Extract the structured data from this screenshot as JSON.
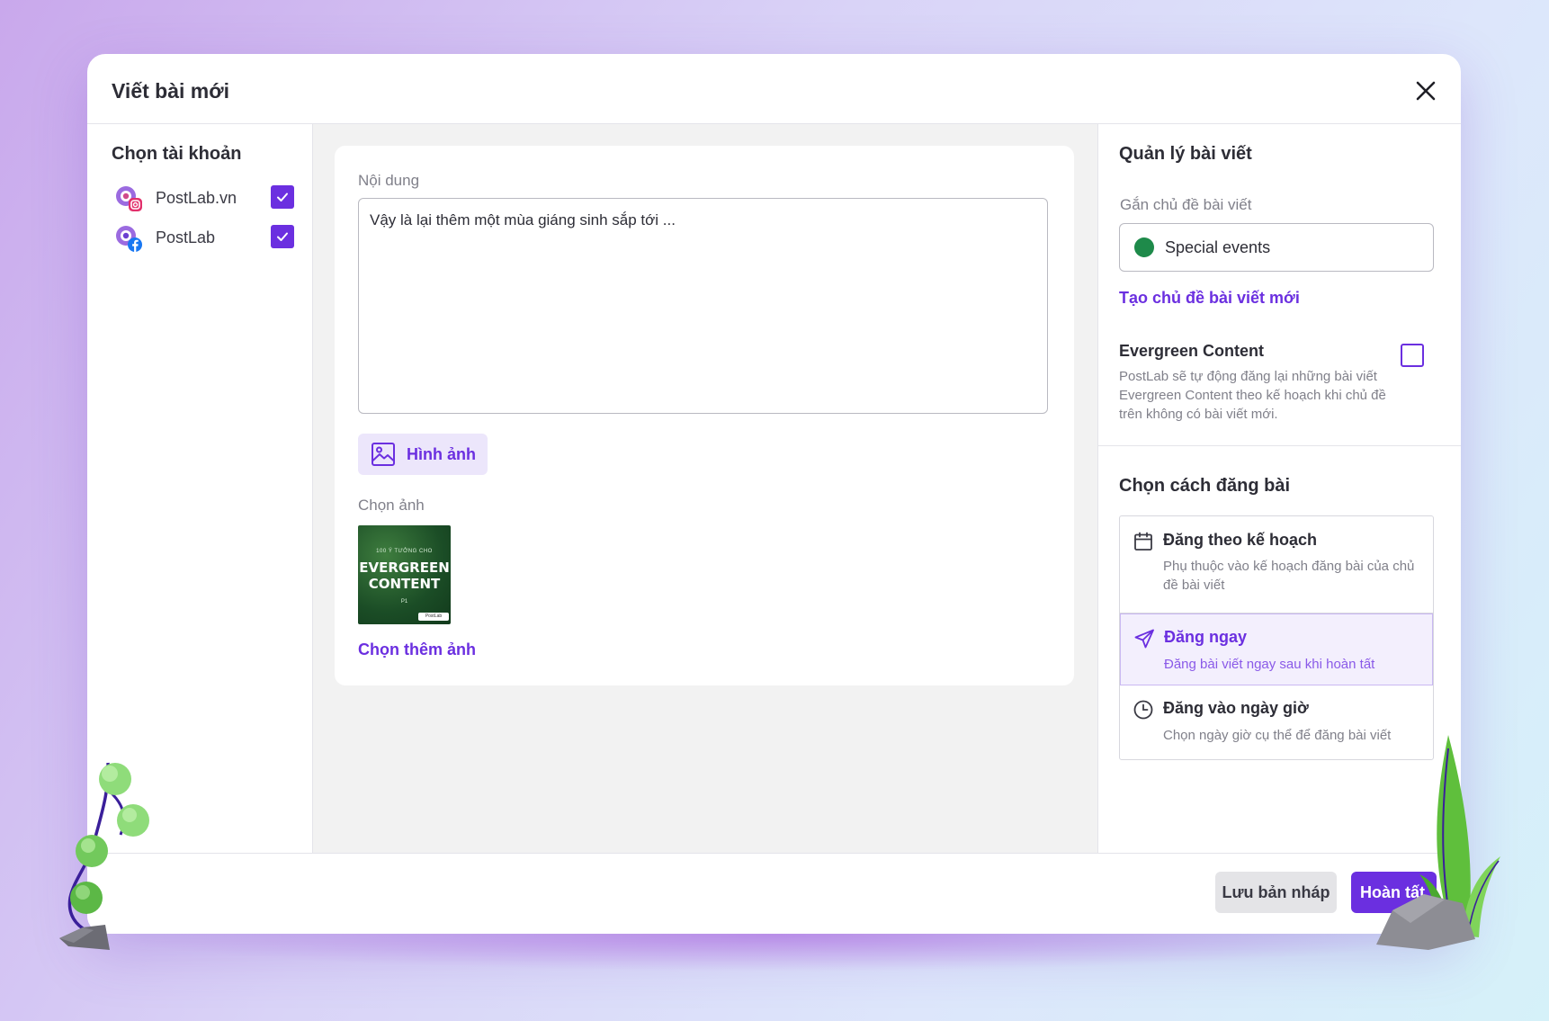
{
  "dialog": {
    "title": "Viết bài mới"
  },
  "accounts": {
    "title": "Chọn tài khoản",
    "items": [
      {
        "name": "PostLab.vn",
        "network": "instagram",
        "checked": true
      },
      {
        "name": "PostLab",
        "network": "facebook",
        "checked": true
      }
    ]
  },
  "editor": {
    "content_label": "Nội dung",
    "content_value": "Vậy là lại thêm một mùa giáng sinh sắp tới ...",
    "image_button": "Hình ảnh",
    "choose_image_label": "Chọn ảnh",
    "thumbnail": {
      "line1": "100 Ý TƯỞNG CHO",
      "line2": "EVERGREEN",
      "line3": "CONTENT",
      "line4": "P1",
      "badge": "PostLab"
    },
    "more_images_link": "Chọn thêm ảnh"
  },
  "management": {
    "title": "Quản lý bài viết",
    "topic_label": "Gắn chủ đề bài viết",
    "topic_value": "Special events",
    "topic_color": "#1e8a4a",
    "new_topic_link": "Tạo chủ đề bài viết mới",
    "evergreen": {
      "title": "Evergreen Content",
      "description": "PostLab sẽ tự động đăng lại những bài viết Evergreen Content theo kế hoạch khi chủ đề trên không có bài viết mới.",
      "checked": false
    }
  },
  "publish": {
    "title": "Chọn cách đăng bài",
    "options": [
      {
        "title": "Đăng theo kế hoạch",
        "description": "Phụ thuộc vào kế hoạch đăng bài của chủ đề bài viết",
        "icon": "calendar-icon",
        "selected": false
      },
      {
        "title": "Đăng ngay",
        "description": "Đăng bài viết ngay sau khi hoàn tất",
        "icon": "send-icon",
        "selected": true
      },
      {
        "title": "Đăng vào ngày giờ",
        "description": "Chọn ngày giờ cụ thể để đăng bài viết",
        "icon": "clock-icon",
        "selected": false
      }
    ]
  },
  "footer": {
    "draft_button": "Lưu bản nháp",
    "done_button": "Hoàn tất"
  },
  "colors": {
    "accent": "#6b2fe0",
    "accent_light": "#ece6fb"
  }
}
